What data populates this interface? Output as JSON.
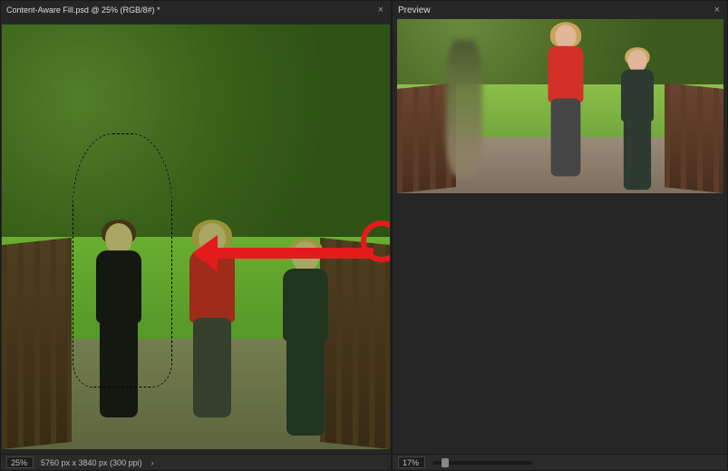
{
  "left_panel": {
    "tab_title": "Content-Aware Fill.psd @ 25% (RGB/8#) *",
    "status": {
      "zoom": "25%",
      "doc_info": "5760 px x 3840 px (300 ppi)"
    }
  },
  "right_panel": {
    "title": "Preview",
    "status": {
      "zoom": "17%"
    }
  },
  "colors": {
    "sampling_overlay": "#6ac82a",
    "annotation": "#e41b1b"
  },
  "icons": {
    "close": "×",
    "chevron_right": "›"
  }
}
